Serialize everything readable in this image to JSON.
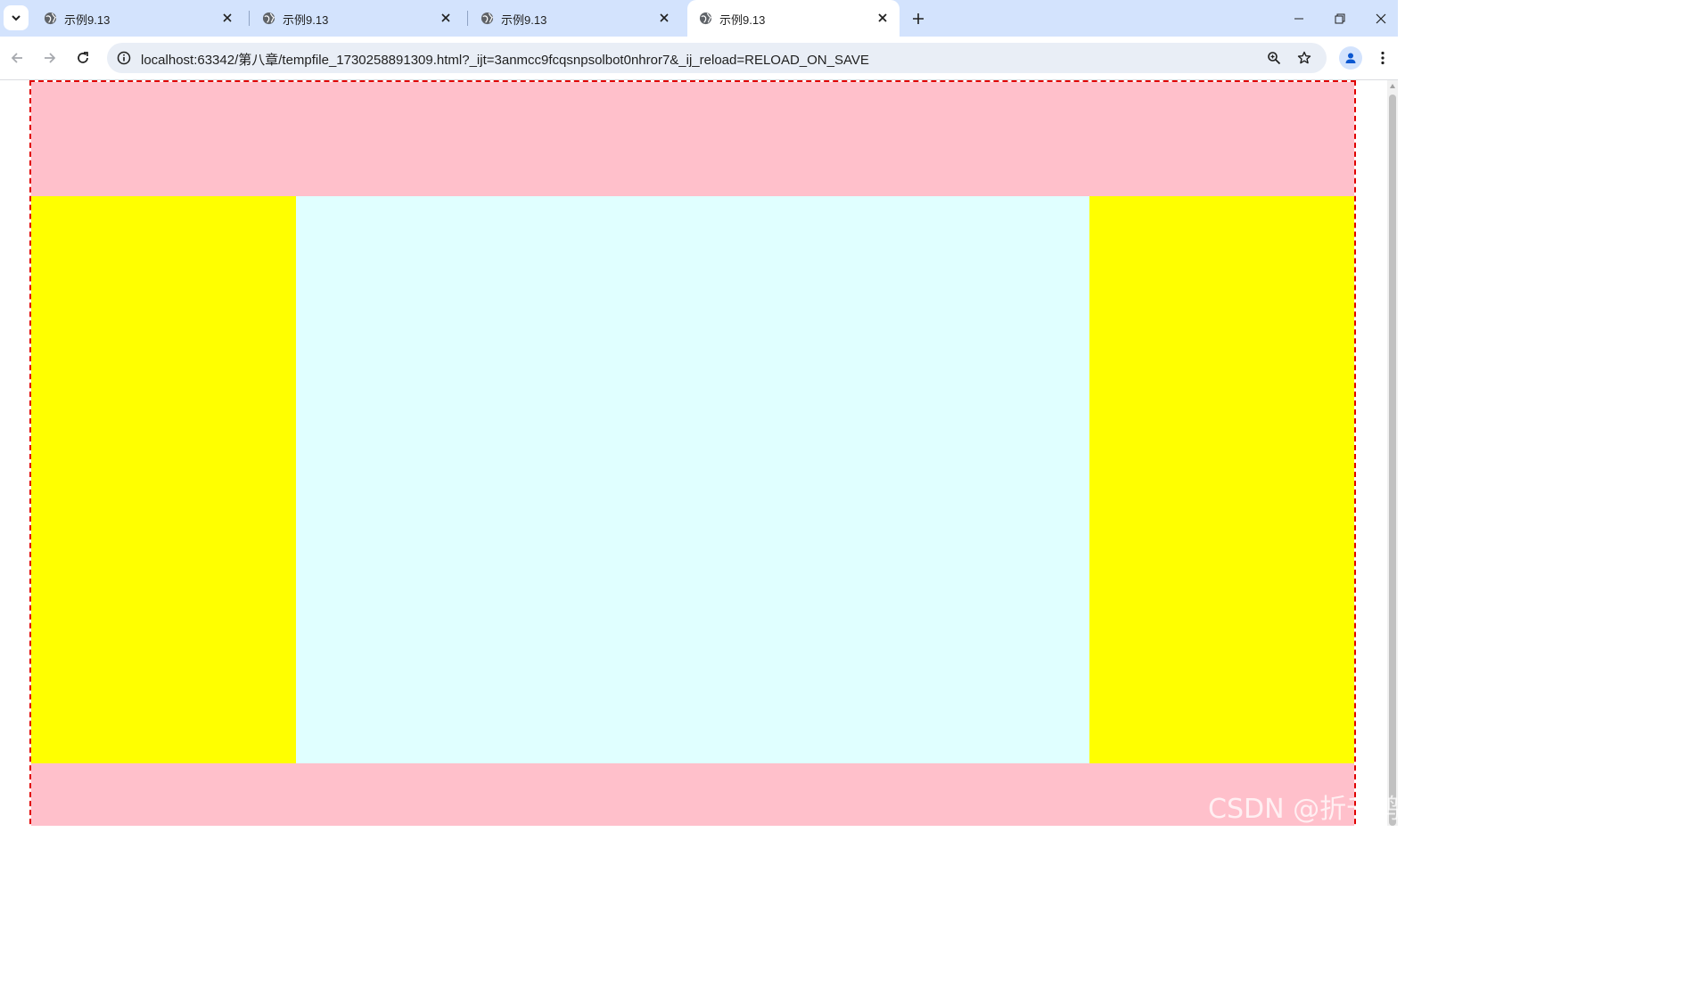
{
  "tabs": [
    {
      "title": "示例9.13",
      "active": false
    },
    {
      "title": "示例9.13",
      "active": false
    },
    {
      "title": "示例9.13",
      "active": false
    },
    {
      "title": "示例9.13",
      "active": true
    }
  ],
  "address_bar": {
    "url": "localhost:63342/第八章/tempfile_1730258891309.html?_ijt=3anmcc9fcqsnpsolbot0nhror7&_ij_reload=RELOAD_ON_SAVE"
  },
  "page": {
    "regions": {
      "header": {
        "color": "#ffc0cb"
      },
      "left": {
        "color": "#ffff00"
      },
      "center": {
        "color": "#e0ffff"
      },
      "right": {
        "color": "#ffff00"
      },
      "footer": {
        "color": "#ffc0cb"
      }
    },
    "border_color": "#e00000"
  },
  "watermark": "CSDN @折千鹤",
  "colors": {
    "tabstrip": "#d3e3fd",
    "omnibox": "#e9eef6"
  }
}
